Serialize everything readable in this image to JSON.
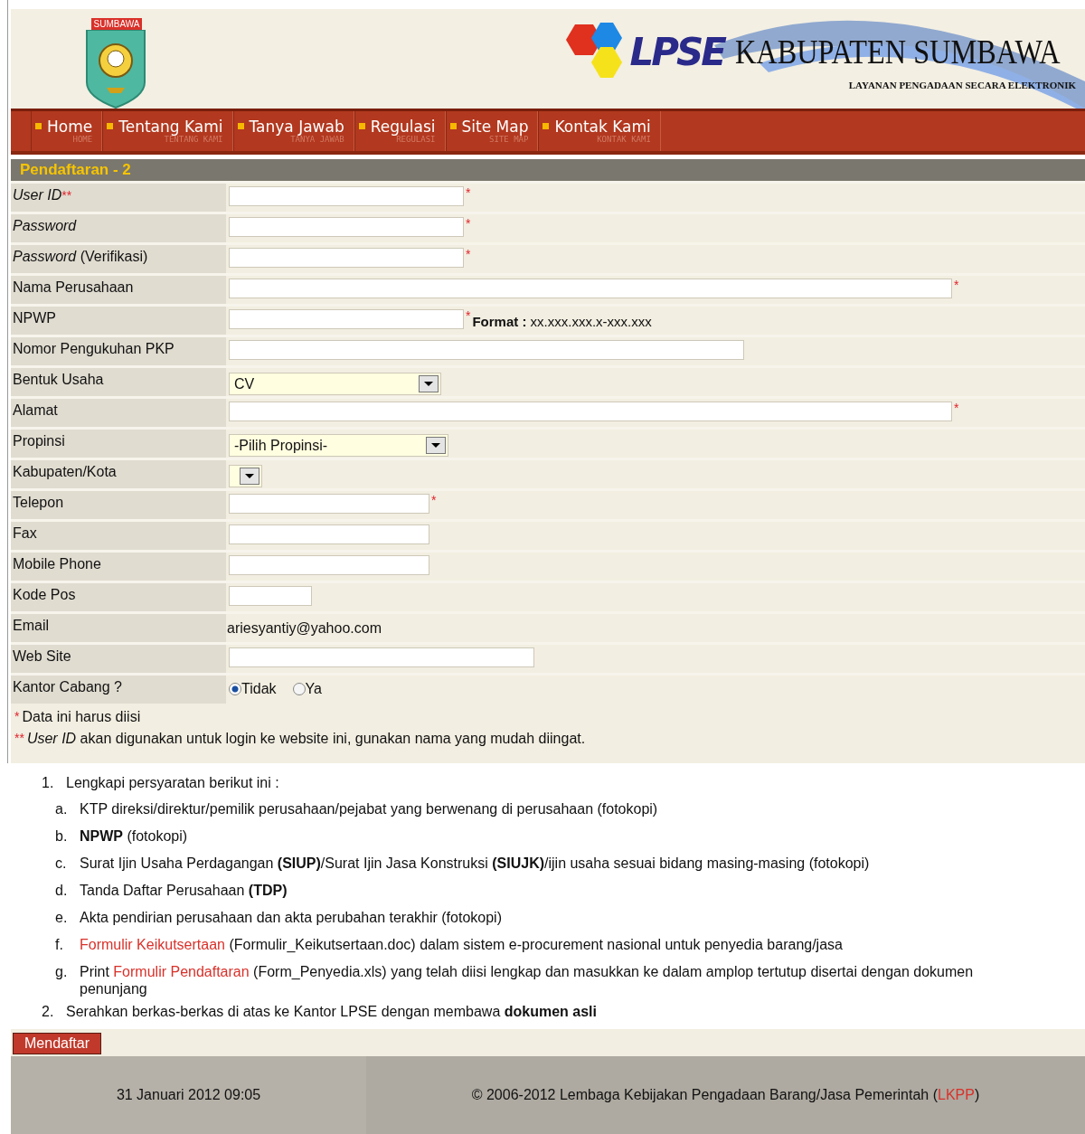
{
  "header": {
    "emblem_text": "SUMBAWA",
    "brand": "LPSE",
    "title": "KABUPATEN SUMBAWA",
    "subtitle": "LAYANAN PENGADAAN SECARA ELEKTRONIK"
  },
  "nav": [
    {
      "label": "Home",
      "sublabel": "HOME"
    },
    {
      "label": "Tentang Kami",
      "sublabel": "TENTANG KAMI"
    },
    {
      "label": "Tanya Jawab",
      "sublabel": "TANYA JAWAB"
    },
    {
      "label": "Regulasi",
      "sublabel": "REGULASI"
    },
    {
      "label": "Site Map",
      "sublabel": "SITE MAP"
    },
    {
      "label": "Kontak Kami",
      "sublabel": "KONTAK KAMI"
    }
  ],
  "page_title": "Pendaftaran - 2",
  "form": [
    {
      "label": "*User ID*",
      "mark": "**",
      "kind": "text",
      "required_mark": "*"
    },
    {
      "label": "*Password*",
      "kind": "password",
      "required_mark": "*"
    },
    {
      "label": "*Password* (Verifikasi)",
      "kind": "password",
      "required_mark": "*"
    },
    {
      "label": "Nama Perusahaan",
      "kind": "text",
      "required_mark": "*"
    },
    {
      "label": "NPWP",
      "kind": "text",
      "required_mark": "*",
      "hint": "**Format :** xx.xxx.xxx.x-xxx.xxx"
    },
    {
      "label": "Nomor Pengukuhan PKP",
      "kind": "text"
    },
    {
      "label": "Bentuk Usaha",
      "kind": "select",
      "value": "CV"
    },
    {
      "label": "Alamat",
      "kind": "text",
      "required_mark": "*"
    },
    {
      "label": "Propinsi",
      "kind": "select",
      "value": "-Pilih Propinsi-"
    },
    {
      "label": "Kabupaten/Kota",
      "kind": "select"
    },
    {
      "label": "Telepon",
      "kind": "text",
      "required_mark": "*"
    },
    {
      "label": "Fax",
      "kind": "text"
    },
    {
      "label": "Mobile Phone",
      "kind": "text"
    },
    {
      "label": "Kode Pos",
      "kind": "text"
    },
    {
      "label": "Email",
      "kind": "static",
      "value": "ariesyantiy@yahoo.com"
    },
    {
      "label": "Web Site",
      "kind": "text"
    },
    {
      "label": "Kantor Cabang ?",
      "kind": "radio",
      "options": [
        {
          "label": "Tidak",
          "selected": true
        },
        {
          "label": "Ya",
          "selected": false
        }
      ]
    }
  ],
  "notes": [
    {
      "mark": "*",
      "text": "Data ini harus diisi"
    },
    {
      "mark": "**",
      "text": "*User ID* akan digunakan untuk login ke website ini, gunakan nama yang mudah diingat."
    }
  ],
  "requirements": [
    {
      "marker": "1.",
      "parts": [
        {
          "kind": "text",
          "text": "Lengkapi persyaratan berikut ini :"
        }
      ],
      "children": [
        {
          "marker": "a.",
          "parts": [
            {
              "kind": "text",
              "text": "KTP direksi/direktur/pemilik perusahaan/pejabat yang berwenang di perusahaan (fotokopi)"
            }
          ]
        },
        {
          "marker": "b.",
          "parts": [
            {
              "kind": "text",
              "text": "**NPWP** (fotokopi)"
            }
          ]
        },
        {
          "marker": "c.",
          "parts": [
            {
              "kind": "text",
              "text": "Surat Ijin Usaha Perdagangan **(SIUP)**/Surat Ijin Jasa Konstruksi **(SIUJK)**/ijin usaha sesuai bidang masing-masing (fotokopi)"
            }
          ]
        },
        {
          "marker": "d.",
          "parts": [
            {
              "kind": "text",
              "text": "Tanda Daftar Perusahaan **(TDP)**"
            }
          ]
        },
        {
          "marker": "e.",
          "parts": [
            {
              "kind": "text",
              "text": "Akta pendirian perusahaan dan akta perubahan terakhir (fotokopi)"
            }
          ]
        },
        {
          "marker": "f.",
          "parts": [
            {
              "kind": "link",
              "text": "Formulir Keikutsertaan"
            },
            {
              "kind": "text",
              "text": " (Formulir_Keikutsertaan.doc) dalam sistem e-procurement nasional untuk penyedia barang/jasa"
            }
          ]
        },
        {
          "marker": "g.",
          "parts": [
            {
              "kind": "text",
              "text": "Print "
            },
            {
              "kind": "link",
              "text": "Formulir Pendaftaran"
            },
            {
              "kind": "text",
              "text": " (Form_Penyedia.xls) yang telah diisi lengkap dan masukkan ke dalam amplop tertutup disertai dengan dokumen penunjang"
            }
          ]
        }
      ]
    },
    {
      "marker": "2.",
      "parts": [
        {
          "kind": "text",
          "text": "Serahkan berkas-berkas di atas ke Kantor LPSE dengan membawa **dokumen asli**"
        }
      ]
    }
  ],
  "submit_button": "Mendaftar",
  "footer": {
    "datetime": "31 Januari 2012 09:05",
    "copyright": [
      {
        "kind": "text",
        "text": "© 2006-2012 Lembaga Kebijakan Pengadaan Barang/Jasa Pemerintah ("
      },
      {
        "kind": "link",
        "text": "LKPP"
      },
      {
        "kind": "text",
        "text": ")"
      }
    ]
  }
}
